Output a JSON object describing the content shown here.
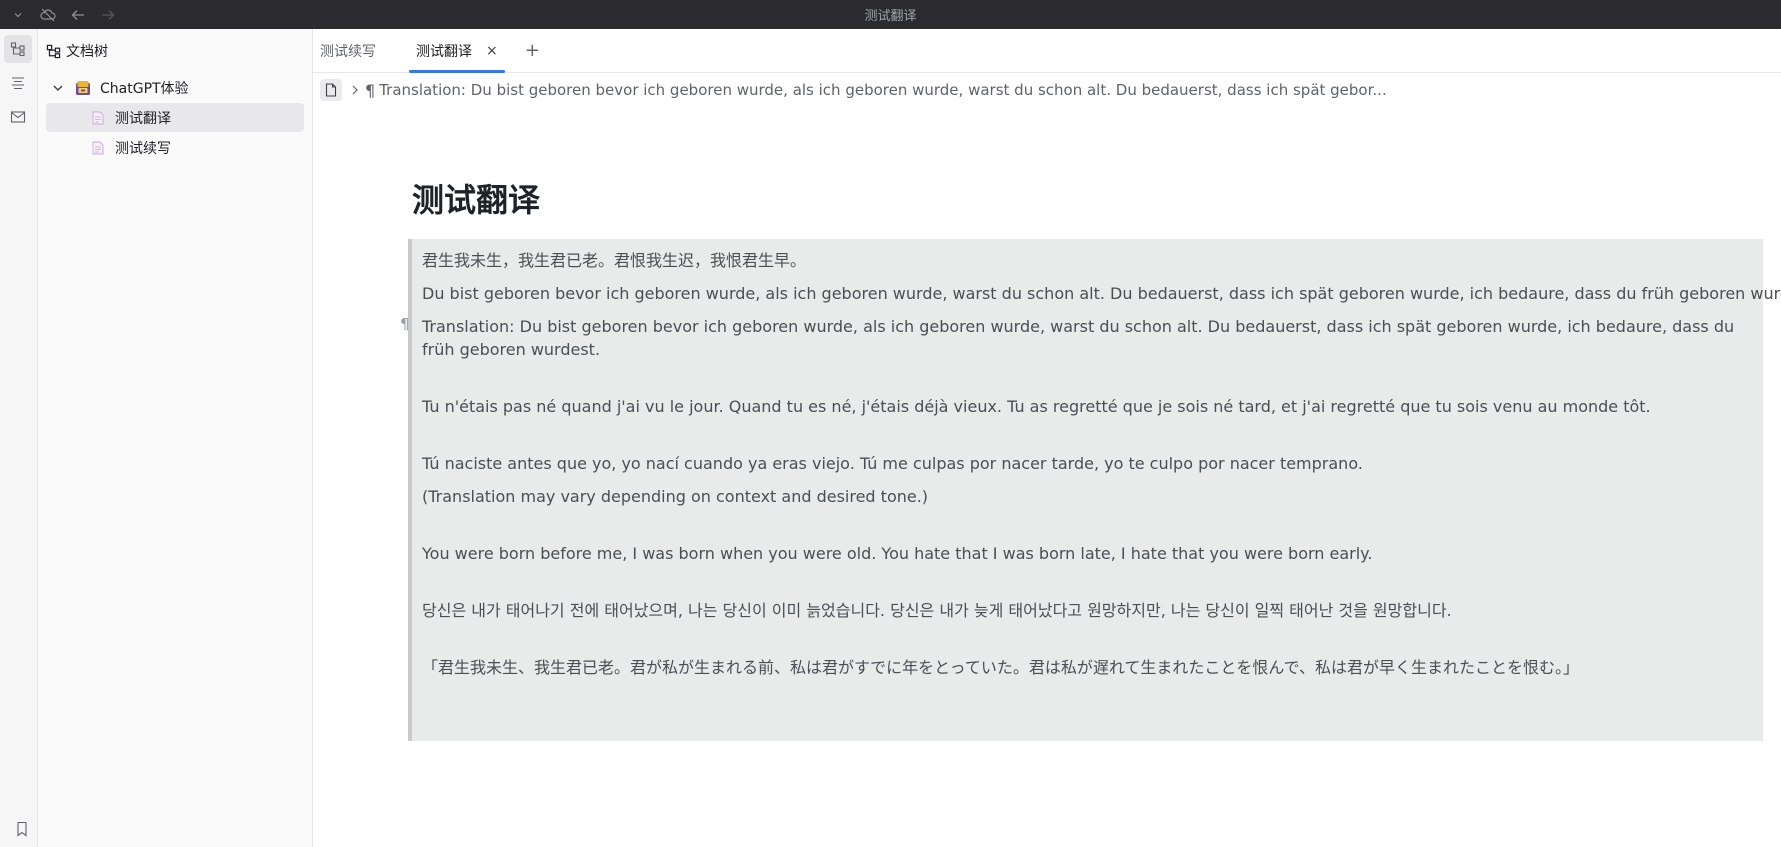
{
  "window": {
    "title": "测试翻译"
  },
  "dock": {
    "items": [
      {
        "name": "file-tree-icon",
        "active": true
      },
      {
        "name": "outline-icon",
        "active": false
      },
      {
        "name": "inbox-icon",
        "active": false
      }
    ],
    "bottom_icon": "bookmark-icon"
  },
  "filetree": {
    "header": "文档树",
    "notebook": {
      "label": "ChatGPT体验",
      "icon": "notebook-icon",
      "expanded": true
    },
    "docs": [
      {
        "label": "测试翻译",
        "selected": true
      },
      {
        "label": "测试续写",
        "selected": false
      }
    ]
  },
  "tabs": {
    "items": [
      {
        "label": "测试续写",
        "active": false
      },
      {
        "label": "测试翻译",
        "active": true
      }
    ],
    "close_glyph": "×",
    "add_glyph": "+"
  },
  "breadcrumb": {
    "para_glyph": "¶",
    "text": "Translation: Du bist geboren bevor ich geboren wurde, als ich geboren wurde, warst du schon alt. Du bedauerst, dass ich spät gebor..."
  },
  "doc": {
    "title": "测试翻译",
    "para_mark": "¶",
    "paragraphs": [
      "君生我未生，我生君已老。君恨我生迟，我恨君生早。",
      "Du bist geboren bevor ich geboren wurde, als ich geboren wurde, warst du schon alt. Du bedauerst, dass ich spät geboren wurde, ich bedaure, dass du früh geboren wurdest.",
      "Translation: Du bist geboren bevor ich geboren wurde, als ich geboren wurde, warst du schon alt. Du bedauerst, dass ich spät geboren wurde, ich bedaure, dass du früh geboren wurdest.",
      "Tu n'étais pas né quand j'ai vu le jour. Quand tu es né, j'étais déjà vieux. Tu as regretté que je sois né tard, et j'ai regretté que tu sois venu au monde tôt.",
      "Tú naciste antes que yo, yo nací cuando ya eras viejo. Tú me culpas por nacer tarde, yo te culpo por nacer temprano.",
      "(Translation may vary depending on context and desired tone.)",
      "You were born before me, I was born when you were old. You hate that I was born late, I hate that you were born early.",
      "당신은 내가 태어나기 전에 태어났으며, 나는 당신이 이미 늙었습니다. 당신은 내가 늦게 태어났다고 원망하지만, 나는 당신이 일찍 태어난 것을 원망합니다.",
      "「君生我未生、我生君已老。君が私が生まれる前、私は君がすでに年をとっていた。君は私が遅れて生まれたことを恨んで、私は君が早く生まれたことを恨む。」"
    ]
  }
}
